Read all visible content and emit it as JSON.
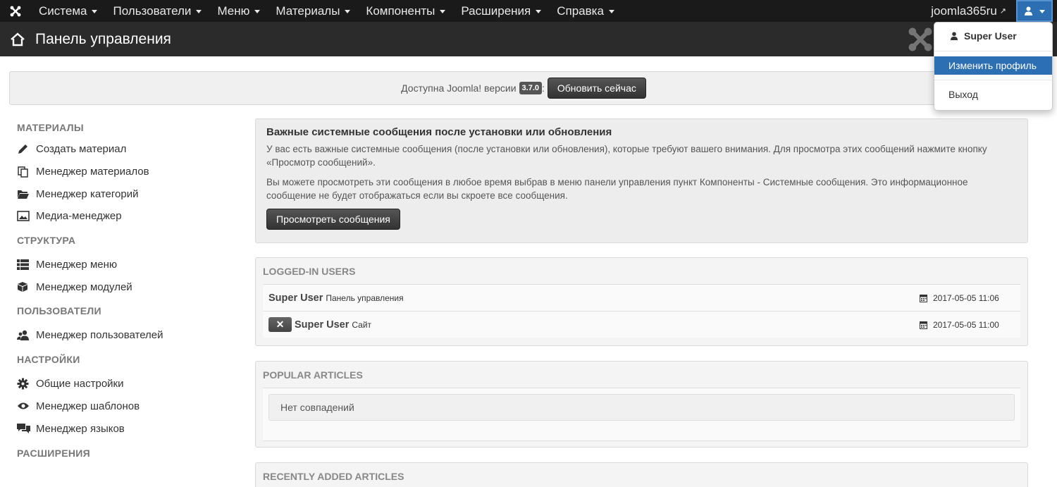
{
  "navbar": {
    "logo_icon": "joomla-logo-icon",
    "menus": [
      "Система",
      "Пользователи",
      "Меню",
      "Материалы",
      "Компоненты",
      "Расширения",
      "Справка"
    ],
    "site_name": "joomla365ru",
    "user_icon": "user-icon"
  },
  "header": {
    "title": "Панель управления",
    "home_icon": "home-icon"
  },
  "update": {
    "text": "Доступна Joomla! версии",
    "version": "3.7.0",
    "colon": ":",
    "button": "Обновить сейчас"
  },
  "sidebar": {
    "sections": [
      {
        "heading": "МАТЕРИАЛЫ",
        "items": [
          {
            "label": "Создать материал",
            "icon": "pencil-icon"
          },
          {
            "label": "Менеджер материалов",
            "icon": "copy-icon"
          },
          {
            "label": "Менеджер категорий",
            "icon": "folder-open-icon"
          },
          {
            "label": "Медиа-менеджер",
            "icon": "picture-icon"
          }
        ]
      },
      {
        "heading": "СТРУКТУРА",
        "items": [
          {
            "label": "Менеджер меню",
            "icon": "list-icon"
          },
          {
            "label": "Менеджер модулей",
            "icon": "cube-icon"
          }
        ]
      },
      {
        "heading": "ПОЛЬЗОВАТЕЛИ",
        "items": [
          {
            "label": "Менеджер пользователей",
            "icon": "users-icon"
          }
        ]
      },
      {
        "heading": "НАСТРОЙКИ",
        "items": [
          {
            "label": "Общие настройки",
            "icon": "cog-icon"
          },
          {
            "label": "Менеджер шаблонов",
            "icon": "eye-icon"
          },
          {
            "label": "Менеджер языков",
            "icon": "comments-icon"
          }
        ]
      },
      {
        "heading": "РАСШИРЕНИЯ",
        "items": []
      }
    ]
  },
  "sysmsg": {
    "title": "Важные системные сообщения после установки или обновления",
    "p1": "У вас есть важные системные сообщения (после установки или обновления), которые требуют вашего внимания. Для просмотра этих сообщений нажмите кнопку «Просмотр сообщений».",
    "p2": "Вы можете просмотреть эти сообщения в любое время выбрав в меню панели управления пункт Компоненты - Системные сообщения. Это информационное сообщение не будет отображаться если вы скроете все сообщения.",
    "button": "Просмотреть сообщения"
  },
  "logged_in": {
    "heading": "LOGGED-IN USERS",
    "rows": [
      {
        "user": "Super User",
        "where": "Панель управления",
        "date": "2017-05-05 11:06",
        "logout": false
      },
      {
        "user": "Super User",
        "where": "Сайт",
        "date": "2017-05-05 11:00",
        "logout": true
      }
    ],
    "logout_glyph": "✕"
  },
  "popular": {
    "heading": "POPULAR ARTICLES",
    "empty": "Нет совпадений"
  },
  "recent": {
    "heading": "RECENTLY ADDED ARTICLES"
  },
  "dropdown": {
    "user": "Super User",
    "items": [
      "Изменить профиль",
      "Выход"
    ]
  },
  "colors": {
    "navbar": "#1a1a1a",
    "header": "#2b2b2b",
    "accent": "#2d6fb3"
  }
}
